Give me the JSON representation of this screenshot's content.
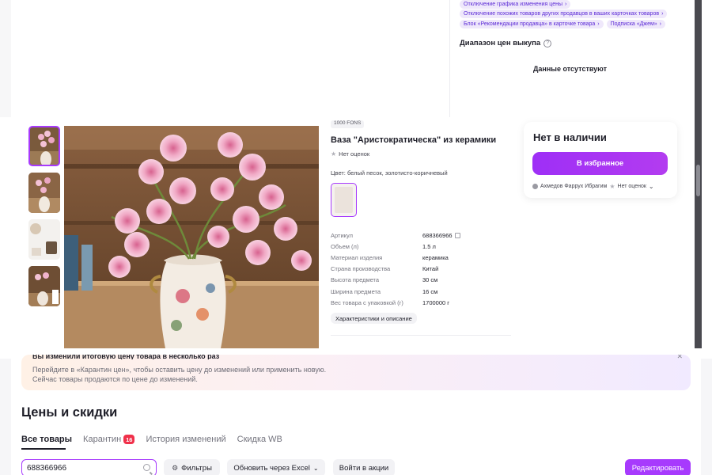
{
  "top_panel": {
    "tags_row1": [
      {
        "label": "Отключение графика изменения цены"
      }
    ],
    "tags_row2": [
      {
        "label": "Отключение похожих товаров других продавцов в ваших карточках товаров"
      }
    ],
    "tags_row3": [
      {
        "label": "Блок «Рекомендации продавца» в карточке товара"
      },
      {
        "label": "Подписка «Джем»"
      }
    ],
    "price_range_title": "Диапазон цен выкупа",
    "no_data": "Данные отсутствуют"
  },
  "product": {
    "shop_tag": "1000 FONS",
    "title": "Ваза \"Аристократическа\" из керамики",
    "rating": "Нет оценок",
    "color": "Цвет: белый песок, золотисто-коричневый",
    "specs": [
      {
        "key": "Артикул",
        "value": "688366966"
      },
      {
        "key": "Объем (л)",
        "value": "1.5 л"
      },
      {
        "key": "Материал изделия",
        "value": "керамика"
      },
      {
        "key": "Страна производства",
        "value": "Китай"
      },
      {
        "key": "Высота предмета",
        "value": "30 см"
      },
      {
        "key": "Ширина предмета",
        "value": "16 см"
      },
      {
        "key": "Вес товара с упаковкой (г)",
        "value": "1700000 г"
      }
    ],
    "specs_button": "Характеристики и описание"
  },
  "buy_card": {
    "stock": "Нет в наличии",
    "favorite_button": "В избранное",
    "seller": "Ахмедов Фаррух Ибрагим",
    "seller_rating": "Нет оценок"
  },
  "notice": {
    "title": "Вы изменили итоговую цену товара в несколько раз",
    "line1": "Перейдите в «Карантин цен», чтобы оставить цену до изменений или применить новую.",
    "line2": "Сейчас товары продаются по цене до изменений."
  },
  "page": {
    "title": "Цены и скидки",
    "tabs": [
      {
        "label": "Все товары"
      },
      {
        "label": "Карантин",
        "badge": "16"
      },
      {
        "label": "История изменений"
      },
      {
        "label": "Скидка WB"
      }
    ]
  },
  "toolbar": {
    "search_value": "688366966",
    "filters": "Фильтры",
    "excel": "Обновить через Excel",
    "promos": "Войти в акции",
    "edit": "Редактировать"
  },
  "colors": {
    "accent": "#a73afd",
    "badge": "#f0304a",
    "tag_bg": "#efe8fb",
    "tag_text": "#5b2ad6"
  }
}
